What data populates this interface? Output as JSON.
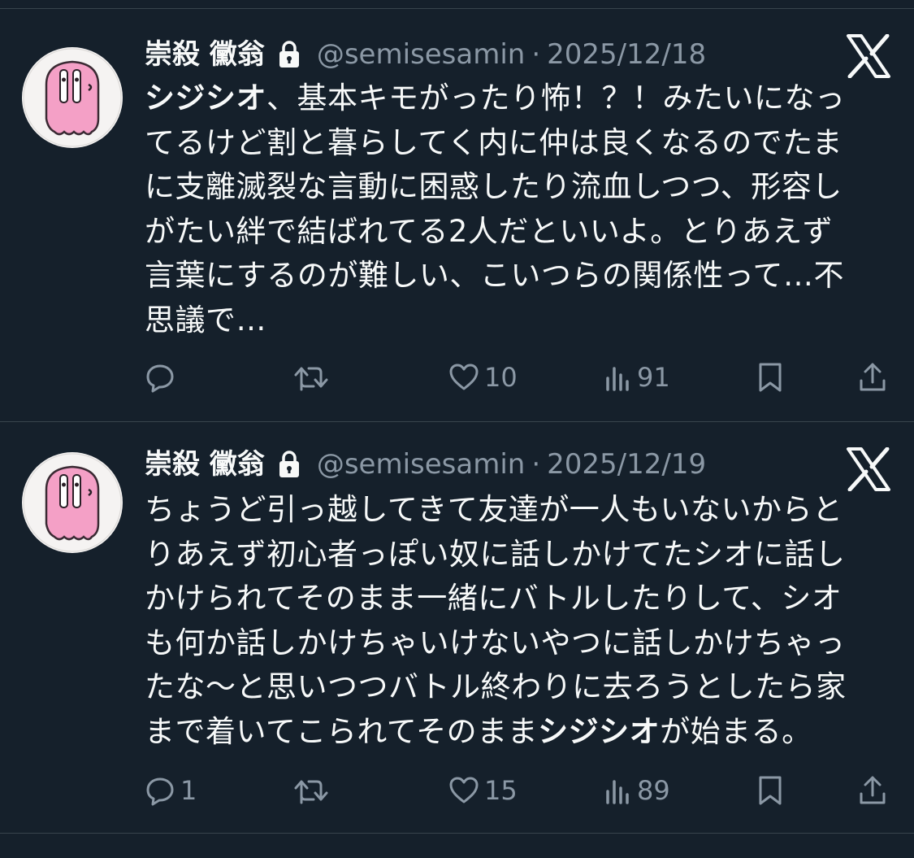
{
  "tweets": [
    {
      "name": "崇殺 黴翁",
      "handle": "@semisesamin",
      "separator": "·",
      "date": "2025/12/18",
      "lines": [
        {
          "bold": "シジシオ",
          "rest": "、基本キモがったり怖！？！みたいになっ"
        },
        {
          "bold": "",
          "rest": "てるけど割と暮らしてく内に仲は良くなるのでたま"
        },
        {
          "bold": "",
          "rest": "に支離滅裂な言動に困惑したり流血しつつ、形容し"
        },
        {
          "bold": "",
          "rest": "がたい絆で結ばれてる2人だといいよ。とりあえず"
        },
        {
          "bold": "",
          "rest": "言葉にするのが難しい、こいつらの関係性って…不"
        },
        {
          "bold": "",
          "rest": "思議で…"
        }
      ],
      "actions": {
        "reply": "",
        "retweet": "",
        "like": "10",
        "views": "91"
      }
    },
    {
      "name": "崇殺 黴翁",
      "handle": "@semisesamin",
      "separator": "·",
      "date": "2025/12/19",
      "lines": [
        {
          "bold": "",
          "rest": "ちょうど引っ越してきて友達が一人もいないからと"
        },
        {
          "bold": "",
          "rest": "りあえず初心者っぽい奴に話しかけてたシオに話し"
        },
        {
          "bold": "",
          "rest": "かけられてそのまま一緒にバトルしたりして、シオ"
        },
        {
          "bold": "",
          "rest": "も何か話しかけちゃいけないやつに話しかけちゃっ"
        },
        {
          "bold": "",
          "rest": "たな〜と思いつつバトル終わりに去ろうとしたら家"
        },
        {
          "bold": "",
          "rest": "まで着いてこられてそのまま",
          "bold2": "シジシオ",
          "rest2": "が始まる。"
        }
      ],
      "actions": {
        "reply": "1",
        "retweet": "",
        "like": "15",
        "views": "89"
      }
    }
  ],
  "icons": [
    "avatar",
    "lock-icon",
    "x-logo-icon",
    "reply-icon",
    "retweet-icon",
    "like-icon",
    "views-icon",
    "bookmark-icon",
    "share-icon"
  ],
  "colors": {
    "background": "#15202b",
    "text": "#f7f9f9",
    "secondary": "#8b98a5",
    "divider": "#38444d",
    "avatar_pink": "#f4a0c6"
  }
}
